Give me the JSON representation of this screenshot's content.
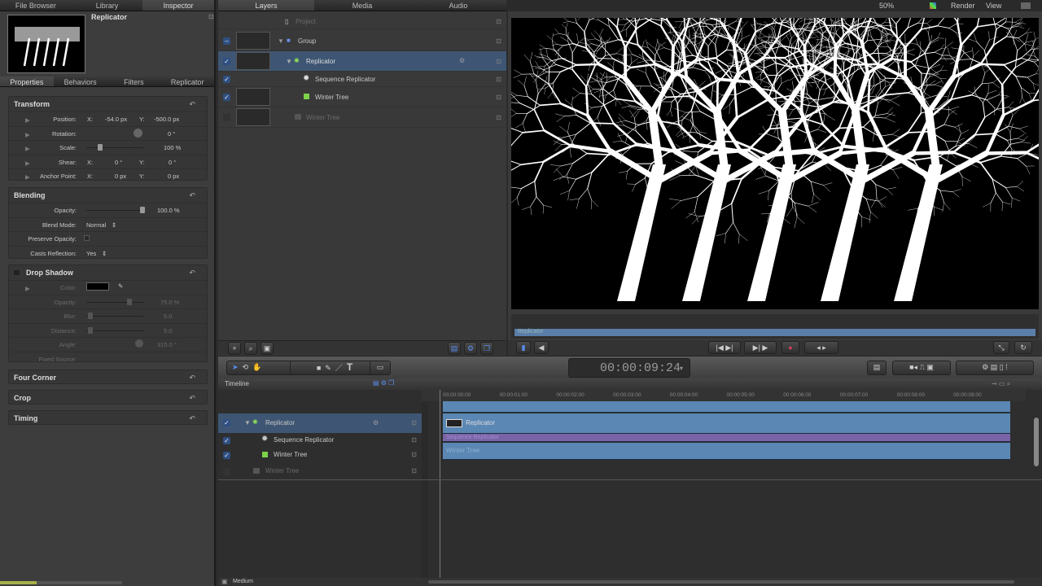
{
  "inspector": {
    "tabs": [
      "File Browser",
      "Library",
      "Inspector"
    ],
    "title": "Replicator",
    "subtabs": [
      "Properties",
      "Behaviors",
      "Filters",
      "Replicator"
    ],
    "transform": {
      "title": "Transform",
      "position": {
        "label": "Position:",
        "x_label": "X:",
        "x": "-54.0 px",
        "y_label": "Y:",
        "y": "-500.0 px"
      },
      "rotation": {
        "label": "Rotation:",
        "value": "0 °"
      },
      "scale": {
        "label": "Scale:",
        "value": "100 %"
      },
      "shear": {
        "label": "Shear:",
        "x_label": "X:",
        "x": "0 °",
        "y_label": "Y:",
        "y": "0 °"
      },
      "anchor": {
        "label": "Anchor Point:",
        "x_label": "X:",
        "x": "0 px",
        "y_label": "Y:",
        "y": "0 px"
      }
    },
    "blending": {
      "title": "Blending",
      "opacity_label": "Opacity:",
      "opacity": "100.0 %",
      "blend_label": "Blend Mode:",
      "blend": "Normal",
      "preserve_label": "Preserve Opacity:",
      "casts_label": "Casts Reflection:",
      "casts": "Yes"
    },
    "shadow": {
      "title": "Drop Shadow",
      "color_label": "Color:",
      "opacity_label": "Opacity:",
      "opacity": "75.0 %",
      "blur_label": "Blur:",
      "blur": "5.0",
      "distance_label": "Distance:",
      "distance": "5.0",
      "angle_label": "Angle:",
      "angle": "315.0 °",
      "fixed_label": "Fixed Source:"
    },
    "collapsed": [
      "Four Corner",
      "Crop",
      "Timing"
    ]
  },
  "layers": {
    "tabs": [
      "Layers",
      "Media",
      "Audio"
    ],
    "project": "Project",
    "group": "Group",
    "replicator": "Replicator",
    "sequence": "Sequence Replicator",
    "tree": "Winter Tree",
    "tree_off": "Winter Tree"
  },
  "viewer": {
    "zoom": "50%",
    "render": "Render",
    "view": "View",
    "mini_track": "Replicator"
  },
  "timecode": "00:00:09:24",
  "timeline": {
    "title": "Timeline",
    "rows": [
      "Replicator",
      "Sequence Replicator",
      "Winter Tree",
      "Winter Tree"
    ],
    "bars": [
      "Replicator",
      "Sequence Replicator",
      "Winter Tree"
    ],
    "ticks": [
      "00:00:00:00",
      "00:00:01:00",
      "00:00:02:00",
      "00:00:03:00",
      "00:00:04:00",
      "00:00:05:00",
      "00:00:06:00",
      "00:00:07:00",
      "00:00:08:00",
      "00:00:09:00"
    ],
    "zoom_label": "Medium"
  }
}
